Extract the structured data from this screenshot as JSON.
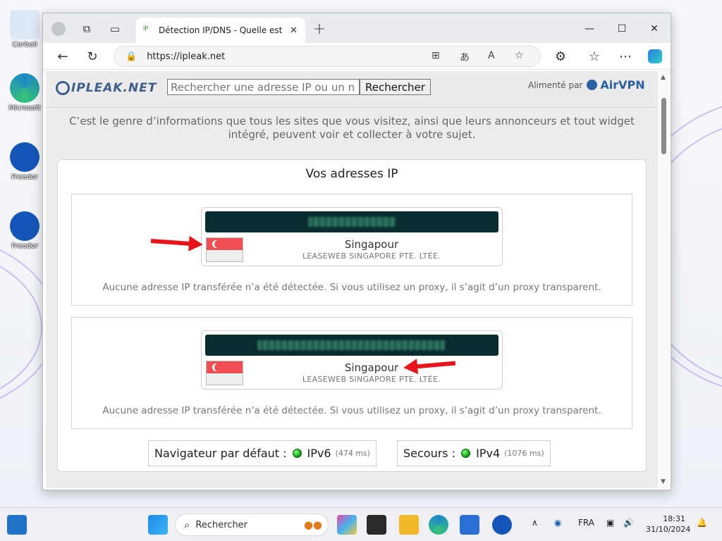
{
  "desktop": {
    "icons": [
      {
        "label": "Corbeil",
        "color": "#dfe8f5"
      },
      {
        "label": "Microsoft",
        "color": "#1e88c7"
      },
      {
        "label": "Freedor",
        "color": "#1456b8"
      },
      {
        "label": "Freedor",
        "color": "#1456b8"
      }
    ]
  },
  "browser": {
    "tab_title": "Détection IP/DNS - Quelle est vot",
    "url": "https://ipleak.net"
  },
  "site": {
    "logo": "IPLEAK.NET",
    "search_placeholder": "Rechercher une adresse IP ou un n",
    "search_button": "Rechercher",
    "powered_by": "Alimenté par",
    "sponsor": "AirVPN",
    "intro": "C’est le genre d’informations que tous les sites que vous visitez, ainsi que leurs annonceurs et tout widget intégré, peuvent voir et collecter à votre sujet.",
    "panel_title": "Vos adresses IP",
    "ip_entries": [
      {
        "country": "Singapour",
        "isp": "LEASEWEB SINGAPORE PTE. LTÉE.",
        "note": "Aucune adresse IP transférée n’a été détectée. Si vous utilisez un proxy, il s’agit d’un proxy transparent."
      },
      {
        "country": "Singapour",
        "isp": "LEASEWEB SINGAPORE PTE. LTÉE.",
        "note": "Aucune adresse IP transférée n’a été détectée. Si vous utilisez un proxy, il s’agit d’un proxy transparent."
      }
    ],
    "default_browser": {
      "label": "Navigateur par défaut :",
      "proto": "IPv6",
      "ms": "(474 ms)"
    },
    "fallback": {
      "label": "Secours :",
      "proto": "IPv4",
      "ms": "(1076 ms)"
    }
  },
  "taskbar": {
    "search_label": "Rechercher",
    "language": "FRA",
    "time": "18:31",
    "date": "31/10/2024"
  },
  "colors": {
    "accent_red_arrow": "#e8141b",
    "status_green": "#19a319",
    "ip_bar": "#082c30",
    "logo_blue": "#3d5f8a"
  }
}
